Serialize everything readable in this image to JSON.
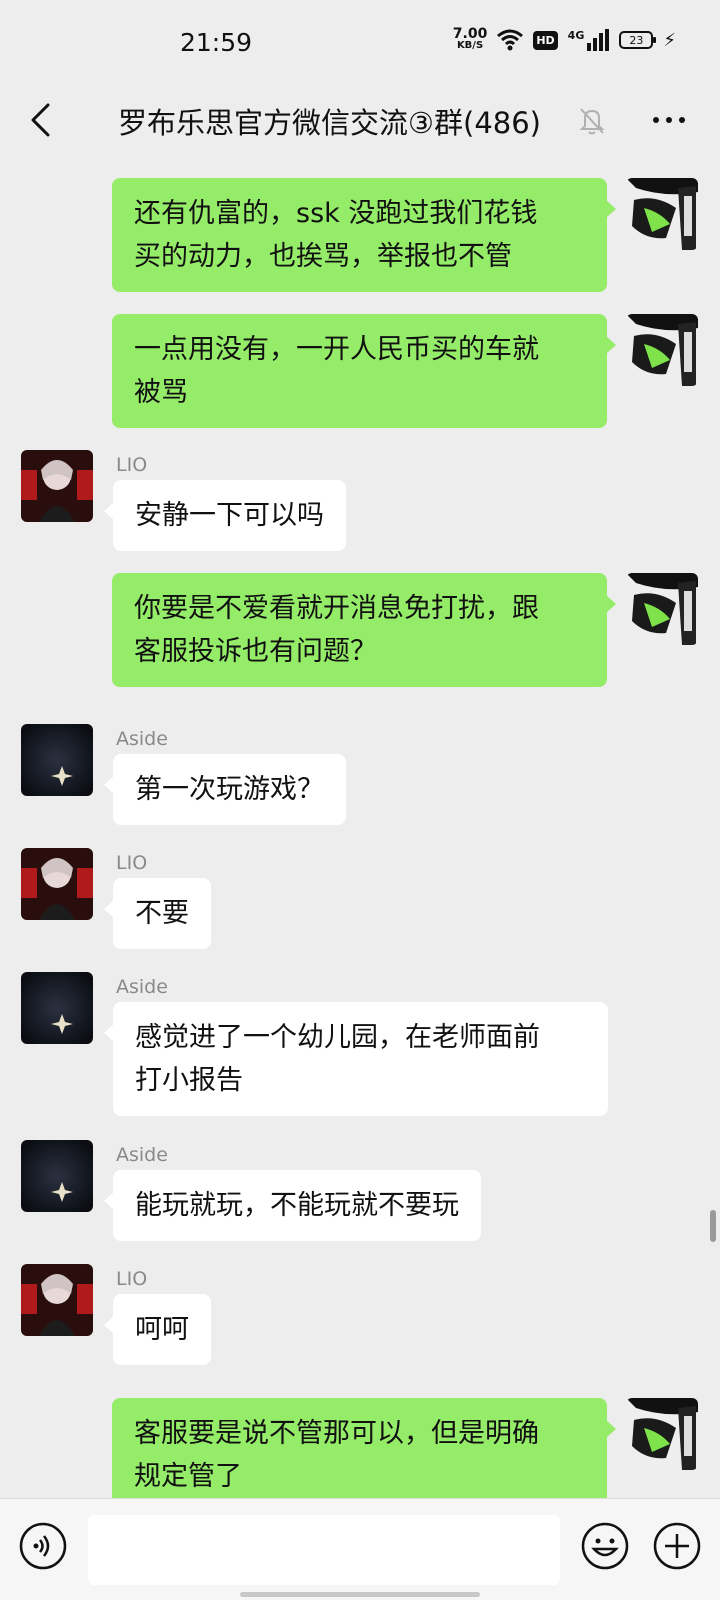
{
  "status_bar": {
    "time": "21:59",
    "net_speed_value": "7.00",
    "net_speed_unit": "KB/S",
    "hd": "HD",
    "network": "4G",
    "battery": "23"
  },
  "header": {
    "title": "罗布乐思官方微信交流③群(486)",
    "back_icon": "chevron-left-icon",
    "mute_icon": "bell-muted-icon",
    "more_icon": "more-dots-icon"
  },
  "messages": [
    {
      "side": "out",
      "sender": "",
      "text": "还有仇富的，ssk 没跑过我们花钱\n买的动力，也挨骂，举报也不管"
    },
    {
      "side": "out",
      "sender": "",
      "text": "一点用没有，一开人民币买的车就\n被骂"
    },
    {
      "side": "in",
      "sender": "LIO",
      "text": "安静一下可以吗"
    },
    {
      "side": "out",
      "sender": "",
      "text": "你要是不爱看就开消息免打扰，跟\n客服投诉也有问题？"
    },
    {
      "side": "in",
      "sender": "Aside",
      "text": "第一次玩游戏？"
    },
    {
      "side": "in",
      "sender": "LIO",
      "text": "不要"
    },
    {
      "side": "in",
      "sender": "Aside",
      "text": "感觉进了一个幼儿园，在老师面前\n打小报告"
    },
    {
      "side": "in",
      "sender": "Aside",
      "text": "能玩就玩，不能玩就不要玩"
    },
    {
      "side": "in",
      "sender": "LIO",
      "text": "呵呵"
    },
    {
      "side": "out",
      "sender": "",
      "text": "客服要是说不管那可以，但是明确\n规定管了"
    }
  ],
  "input_bar": {
    "placeholder": "",
    "voice_icon": "voice-icon",
    "emoji_icon": "emoji-icon",
    "plus_icon": "plus-icon"
  },
  "colors": {
    "background": "#ededed",
    "outgoing_bubble": "#95ec69",
    "incoming_bubble": "#ffffff",
    "sender_name": "#8a8a8a"
  }
}
